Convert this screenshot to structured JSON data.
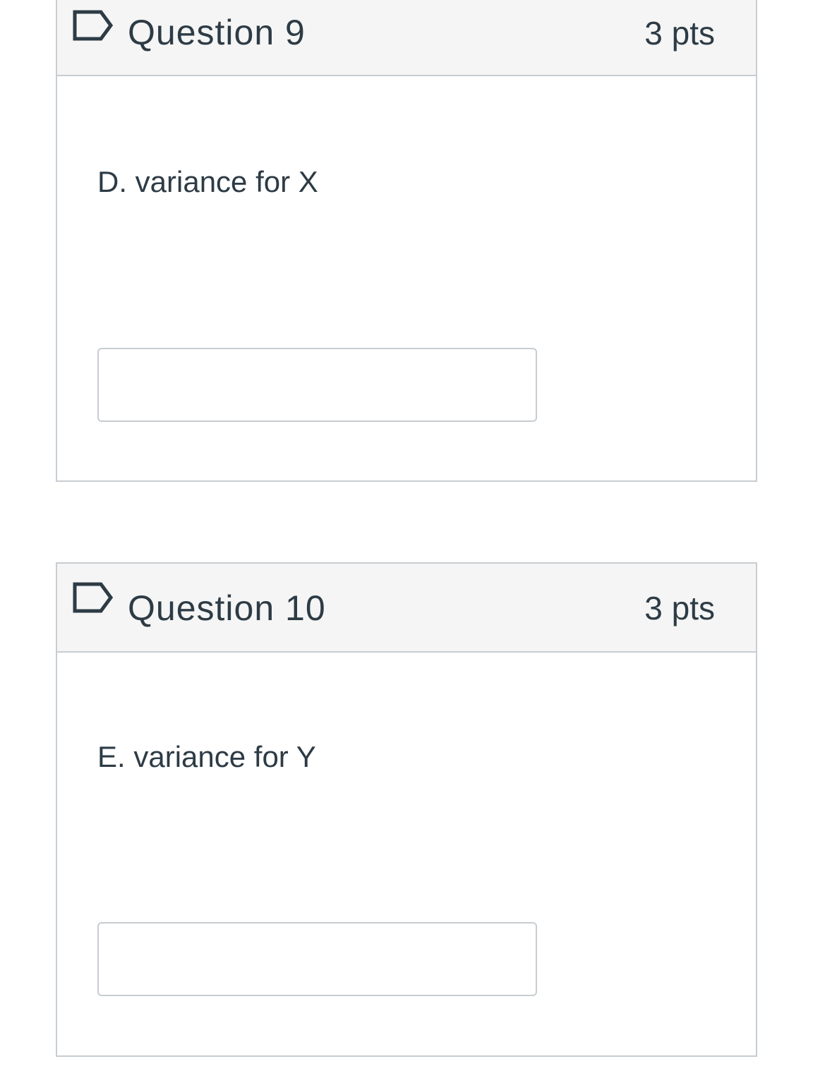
{
  "questions": [
    {
      "title": "Question 9",
      "points": "3 pts",
      "prompt": "D. variance for X",
      "answer_value": ""
    },
    {
      "title": "Question 10",
      "points": "3 pts",
      "prompt": "E. variance for Y",
      "answer_value": ""
    }
  ],
  "icons": {
    "flag": "flag-bookmark-icon"
  },
  "colors": {
    "header_background": "#f5f5f5",
    "border": "#c7cdd1",
    "text": "#2d3b45"
  }
}
